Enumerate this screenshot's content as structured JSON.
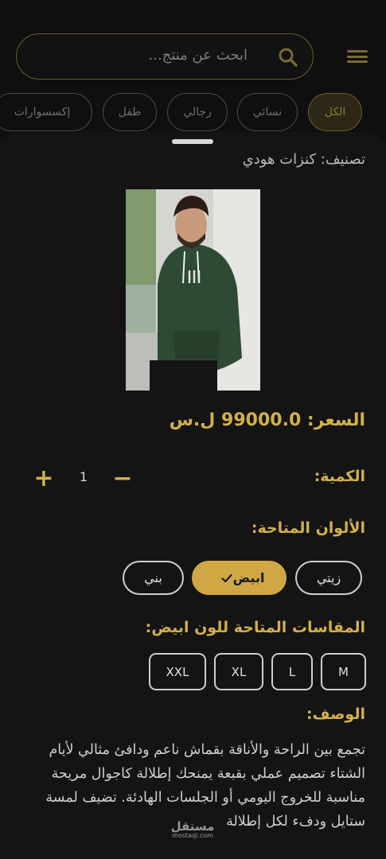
{
  "header": {
    "search_placeholder": "ابحث عن منتج...",
    "icons": {
      "menu": "menu-icon",
      "search": "search-icon"
    }
  },
  "filters": [
    {
      "label": "الكل",
      "active": true
    },
    {
      "label": "نسائي",
      "active": false
    },
    {
      "label": "رجالي",
      "active": false
    },
    {
      "label": "طفل",
      "active": false
    },
    {
      "label": "إكسسوارات",
      "active": false
    }
  ],
  "product": {
    "category": "تصنيف: كنزات هودي",
    "price": "السعر: 99000.0 ل.س",
    "quantity_label": "الكمية:",
    "quantity": "1",
    "colors_label": "الألوان المتاحة:",
    "colors": [
      {
        "label": "زيتي",
        "selected": false
      },
      {
        "label": "ابيض",
        "selected": true
      },
      {
        "label": "بني",
        "selected": false
      }
    ],
    "sizes_label": "المقاسات المتاحة للون ابيض:",
    "sizes": [
      "M",
      "L",
      "XL",
      "XXL"
    ],
    "description_label": "الوصف:",
    "description": "تجمع بين الراحة والأناقة بقماش ناعم ودافئ مثالي لأيام الشتاء تصميم عملي بقبعة يمنحك إطلالة كاجوال مريحة مناسبة للخروج اليومي أو الجلسات الهادئة. تضيف لمسة ستايل ودفء لكل إطلالة"
  },
  "watermark": {
    "logo": "مستقل",
    "site": "mostaql.com"
  },
  "colors": {
    "accent": "#d2b04a",
    "background": "#141414",
    "selected_chip": "#cfa845"
  }
}
